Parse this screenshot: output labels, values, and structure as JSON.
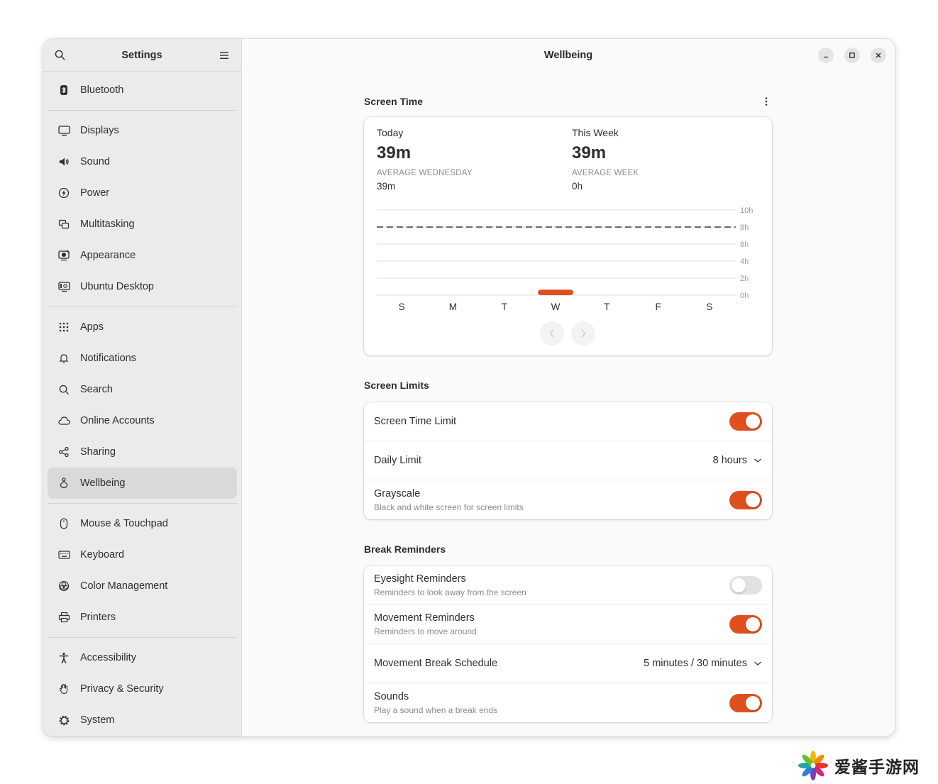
{
  "sidebar": {
    "title": "Settings",
    "groups": [
      [
        {
          "label": "Bluetooth",
          "icon": "bluetooth-icon"
        }
      ],
      [
        {
          "label": "Displays",
          "icon": "display-icon"
        },
        {
          "label": "Sound",
          "icon": "speaker-icon"
        },
        {
          "label": "Power",
          "icon": "power-icon"
        },
        {
          "label": "Multitasking",
          "icon": "multitasking-icon"
        },
        {
          "label": "Appearance",
          "icon": "appearance-icon"
        },
        {
          "label": "Ubuntu Desktop",
          "icon": "ubuntu-desktop-icon"
        }
      ],
      [
        {
          "label": "Apps",
          "icon": "apps-grid-icon"
        },
        {
          "label": "Notifications",
          "icon": "bell-icon"
        },
        {
          "label": "Search",
          "icon": "search-icon"
        },
        {
          "label": "Online Accounts",
          "icon": "cloud-icon"
        },
        {
          "label": "Sharing",
          "icon": "share-icon"
        },
        {
          "label": "Wellbeing",
          "icon": "wellbeing-icon",
          "active": true
        }
      ],
      [
        {
          "label": "Mouse & Touchpad",
          "icon": "mouse-icon"
        },
        {
          "label": "Keyboard",
          "icon": "keyboard-icon"
        },
        {
          "label": "Color Management",
          "icon": "color-icon"
        },
        {
          "label": "Printers",
          "icon": "printer-icon"
        }
      ],
      [
        {
          "label": "Accessibility",
          "icon": "accessibility-icon"
        },
        {
          "label": "Privacy & Security",
          "icon": "hand-icon"
        },
        {
          "label": "System",
          "icon": "gear-icon"
        }
      ]
    ]
  },
  "header": {
    "title": "Wellbeing"
  },
  "screen_time": {
    "section_title": "Screen Time",
    "today": {
      "label": "Today",
      "value": "39m",
      "avg_label": "AVERAGE WEDNESDAY",
      "avg_value": "39m"
    },
    "week": {
      "label": "This Week",
      "value": "39m",
      "avg_label": "AVERAGE WEEK",
      "avg_value": "0h"
    }
  },
  "chart_data": {
    "type": "bar",
    "categories": [
      "S",
      "M",
      "T",
      "W",
      "T",
      "F",
      "S"
    ],
    "values": [
      0,
      0,
      0,
      0.65,
      0,
      0,
      0
    ],
    "ylim": [
      0,
      10
    ],
    "yticks": [
      "10h",
      "8h",
      "6h",
      "4h",
      "2h",
      "0h"
    ],
    "limit_line": 8,
    "bar_color": "#e0501f"
  },
  "screen_limits": {
    "section_title": "Screen Limits",
    "screen_time_limit": {
      "label": "Screen Time Limit",
      "on": true
    },
    "daily_limit": {
      "label": "Daily Limit",
      "value": "8 hours"
    },
    "grayscale": {
      "label": "Grayscale",
      "sub": "Black and white screen for screen limits",
      "on": true
    }
  },
  "break_reminders": {
    "section_title": "Break Reminders",
    "eyesight": {
      "label": "Eyesight Reminders",
      "sub": "Reminders to look away from the screen",
      "on": false
    },
    "movement": {
      "label": "Movement Reminders",
      "sub": "Reminders to move around",
      "on": true
    },
    "schedule": {
      "label": "Movement Break Schedule",
      "value": "5 minutes / 30 minutes"
    },
    "sounds": {
      "label": "Sounds",
      "sub": "Play a sound when a break ends",
      "on": true
    }
  },
  "watermark": {
    "text": "爱酱手游网"
  },
  "colors": {
    "accent": "#e0501f"
  }
}
